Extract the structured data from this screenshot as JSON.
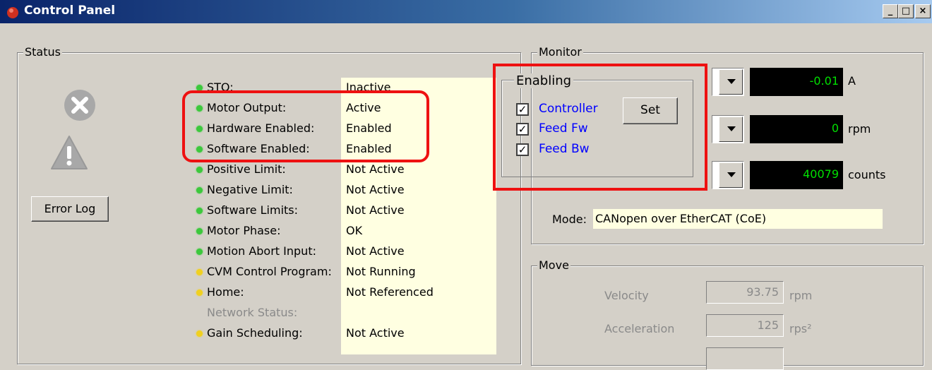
{
  "window": {
    "title": "Control Panel",
    "buttons": [
      "_",
      "□",
      "×"
    ]
  },
  "status": {
    "label": "Status",
    "error_log_label": "Error Log",
    "rows": [
      {
        "label": "STO:",
        "value": "Inactive",
        "color": "#3cc83c"
      },
      {
        "label": "Motor Output:",
        "value": "Active",
        "color": "#3cc83c"
      },
      {
        "label": "Hardware Enabled:",
        "value": "Enabled",
        "color": "#3cc83c"
      },
      {
        "label": "Software Enabled:",
        "value": "Enabled",
        "color": "#3cc83c"
      },
      {
        "label": "Positive Limit:",
        "value": "Not Active",
        "color": "#3cc83c"
      },
      {
        "label": "Negative Limit:",
        "value": "Not Active",
        "color": "#3cc83c"
      },
      {
        "label": "Software Limits:",
        "value": "Not Active",
        "color": "#3cc83c"
      },
      {
        "label": "Motor Phase:",
        "value": "OK",
        "color": "#3cc83c"
      },
      {
        "label": "Motion Abort Input:",
        "value": "Not Active",
        "color": "#3cc83c"
      },
      {
        "label": "CVM Control Program:",
        "value": "Not Running",
        "color": "#f0d020"
      },
      {
        "label": "Home:",
        "value": "Not Referenced",
        "color": "#f0d020"
      },
      {
        "label": "Network Status:",
        "value": "",
        "color": ""
      },
      {
        "label": "Gain Scheduling:",
        "value": "Not Active",
        "color": "#f0d020"
      }
    ]
  },
  "monitor": {
    "label": "Monitor",
    "readouts": [
      {
        "value": "-0.01",
        "unit": "A"
      },
      {
        "value": "0",
        "unit": "rpm"
      },
      {
        "value": "40079",
        "unit": "counts"
      }
    ],
    "mode_label": "Mode:",
    "mode_value": "CANopen over EtherCAT (CoE)"
  },
  "enabling": {
    "label": "Enabling",
    "set_label": "Set",
    "items": [
      {
        "label": "Controller",
        "checked": true
      },
      {
        "label": "Feed Fw",
        "checked": true
      },
      {
        "label": "Feed Bw",
        "checked": true
      }
    ]
  },
  "move": {
    "label": "Move",
    "velocity_label": "Velocity",
    "velocity_value": "93.75",
    "velocity_unit": "rpm",
    "acceleration_label": "Acceleration",
    "acceleration_value": "125",
    "acceleration_unit": "rps²"
  },
  "colors": {
    "highlight": "#ee1111",
    "link_blue": "#0000ff",
    "lcd_green": "#00e000"
  }
}
